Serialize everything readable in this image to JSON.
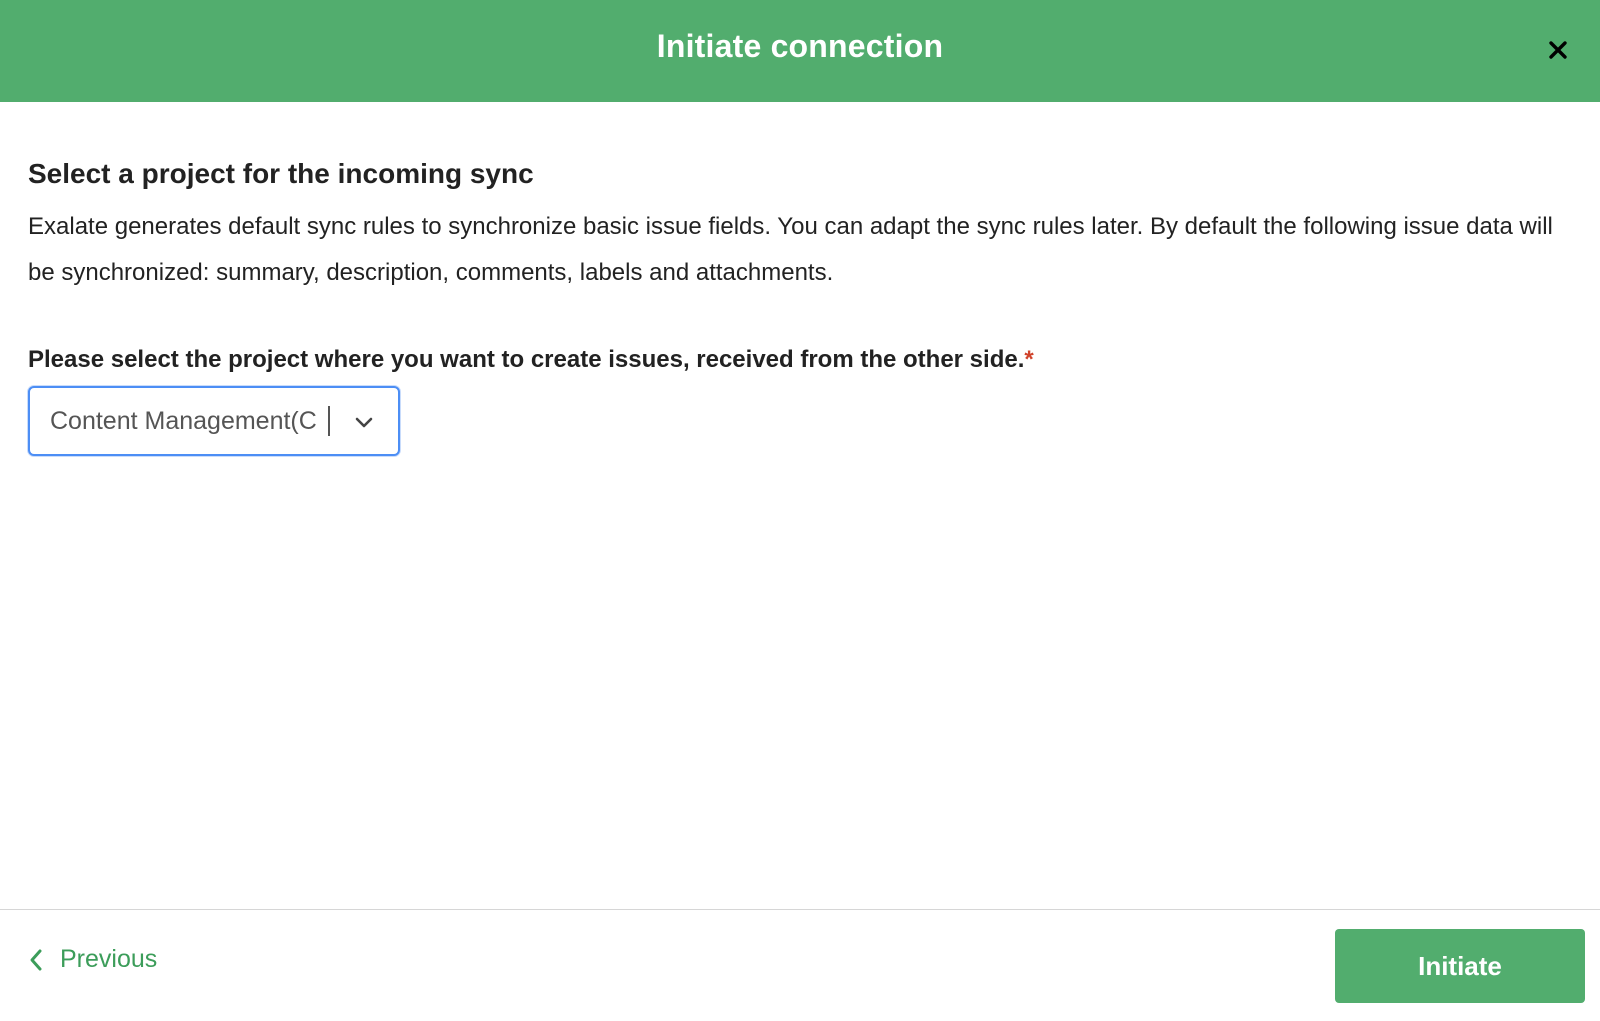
{
  "header": {
    "title": "Initiate connection",
    "close_icon": "close-icon"
  },
  "content": {
    "section_title": "Select a project for the incoming sync",
    "description": "Exalate generates default sync rules to synchronize basic issue fields. You can adapt the sync rules later. By default the following issue data will be synchronized: summary, description, comments, labels and attachments.",
    "field_label": "Please select the project where you want to create issues, received from the other side.",
    "required_marker": "*",
    "project_select": {
      "value": "Content Management(C"
    }
  },
  "footer": {
    "previous_label": "Previous",
    "initiate_label": "Initiate"
  },
  "colors": {
    "brand_green": "#52ad6e",
    "link_green": "#3c9d5a",
    "focus_blue": "#4c8ef5",
    "required_red": "#d0432b"
  }
}
